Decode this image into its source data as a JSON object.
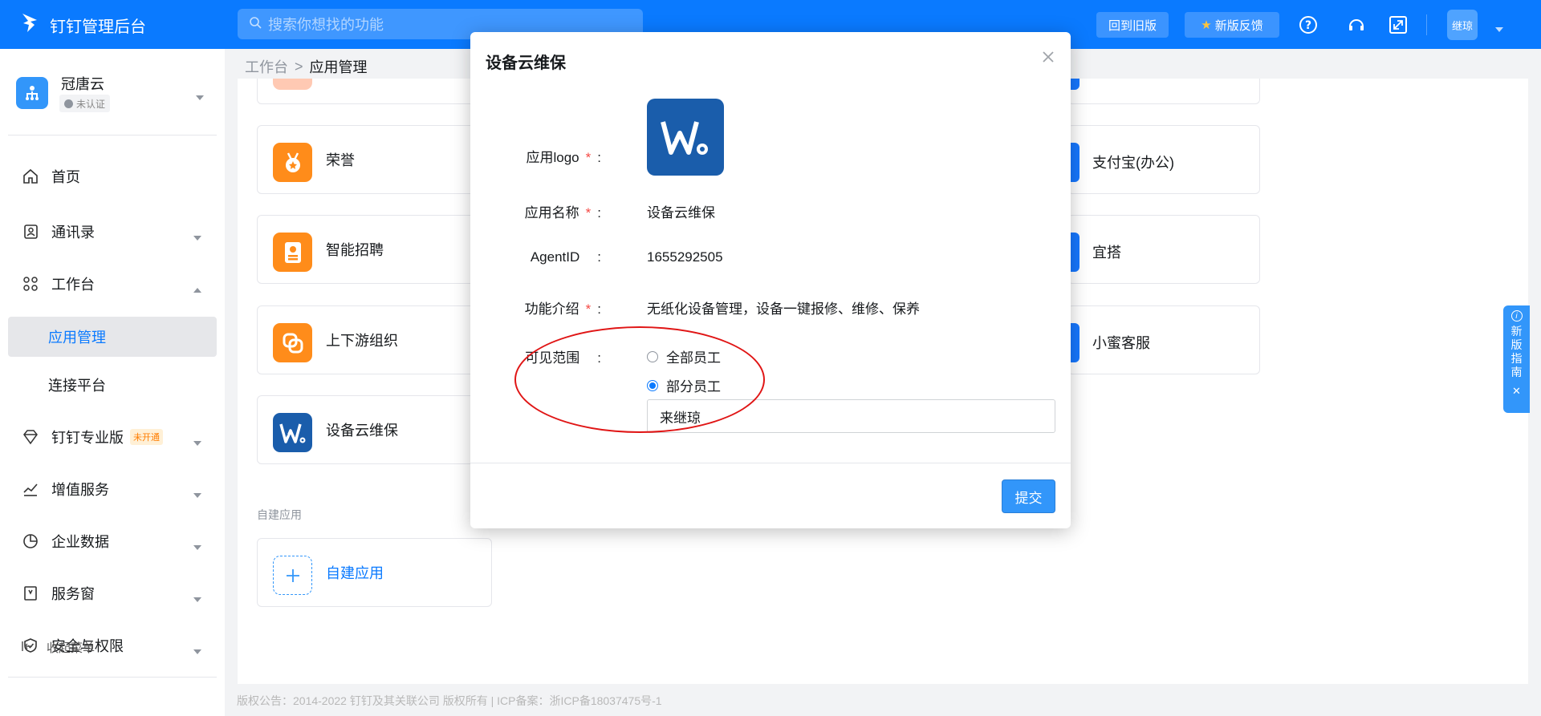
{
  "topbar": {
    "brand": "钉钉管理后台",
    "search_placeholder": "搜索你想找的功能",
    "back_old": "回到旧版",
    "feedback": "新版反馈",
    "avatar_text": "继琼"
  },
  "org": {
    "name": "冠唐云",
    "badge": "未认证"
  },
  "nav": {
    "home": "首页",
    "contacts": "通讯录",
    "workbench": "工作台",
    "app_manage": "应用管理",
    "connect": "连接平台",
    "pro": "钉钉专业版",
    "pro_tag": "未开通",
    "value_added": "增值服务",
    "enterprise_data": "企业数据",
    "service_window": "服务窗",
    "security": "安全与权限",
    "collapse": "收起菜单"
  },
  "breadcrumb": {
    "root": "工作台",
    "sep": ">",
    "current": "应用管理"
  },
  "apps": [
    {
      "name": "荣誉"
    },
    {
      "name": "智能招聘"
    },
    {
      "name": "上下游组织"
    },
    {
      "name": "设备云维保"
    }
  ],
  "right_apps": [
    {
      "name": "支付宝(办公)"
    },
    {
      "name": "宜搭"
    },
    {
      "name": "小蜜客服"
    }
  ],
  "custom": {
    "section_label": "自建应用",
    "add_label": "自建应用"
  },
  "guide": [
    "新",
    "版",
    "指",
    "南"
  ],
  "footer": "版权公告：2014-2022 钉钉及其关联公司 版权所有 | ICP备案：浙ICP备18037475号-1",
  "modal": {
    "title": "设备云维保",
    "logo_label": "应用logo",
    "name_label": "应用名称",
    "name_value": "设备云维保",
    "agent_label": "AgentID",
    "agent_value": "1655292505",
    "desc_label": "功能介绍",
    "desc_value": "无纸化设备管理，设备一键报修、维修、保养",
    "scope_label": "可见范围",
    "scope_all": "全部员工",
    "scope_part": "部分员工",
    "people_value": "来继琼",
    "required_mark": "*",
    "colon": ":",
    "submit": "提交"
  },
  "colors": {
    "primary": "#0a7aff",
    "button": "#3296fa",
    "orange_icon": "#ff8c1a",
    "brand_blue_icon": "#1a5dab",
    "annotation_red": "#e01515"
  }
}
